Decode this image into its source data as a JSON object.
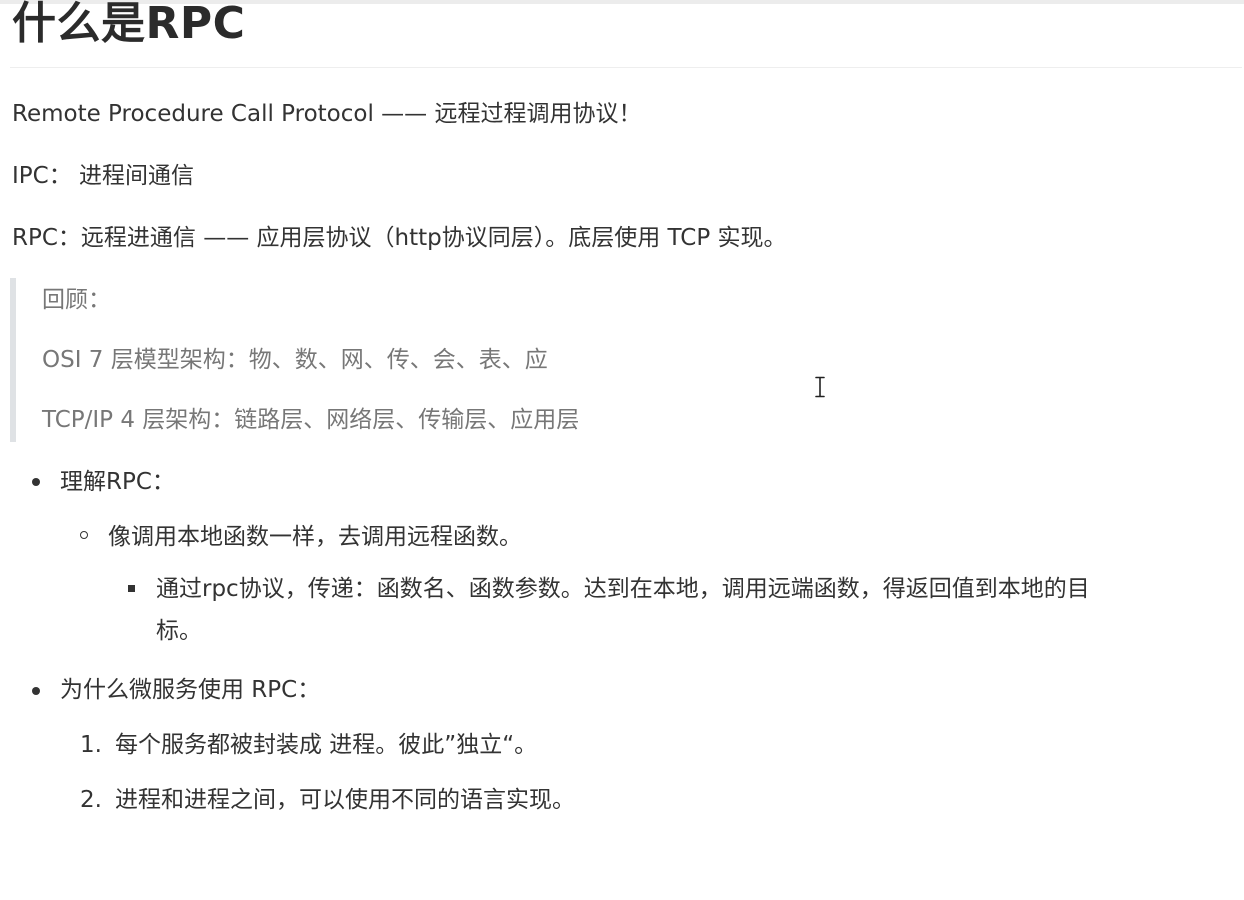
{
  "heading": "什么是RPC",
  "paragraphs": {
    "p1": "Remote Procedure Call Protocol   —— 远程过程调用协议！",
    "p2": "IPC：  进程间通信",
    "p3": "RPC：远程进通信 —— 应用层协议（http协议同层）。底层使用 TCP 实现。"
  },
  "quote": {
    "line1": "回顾：",
    "line2": "OSI 7 层模型架构：物、数、网、传、会、表、应",
    "line3": "TCP/IP 4 层架构：链路层、网络层、传输层、应用层"
  },
  "list1": {
    "title": "理解RPC：",
    "sub": "像调用本地函数一样，去调用远程函数。",
    "subsub_line1": "通过rpc协议，传递：函数名、函数参数。达到在本地，调用远端函数，得返回值到本地的目",
    "subsub_line2": "标。"
  },
  "list2": {
    "title": "为什么微服务使用 RPC：",
    "items": [
      {
        "num": "1.",
        "text": "每个服务都被封装成 进程。彼此”独立“。"
      },
      {
        "num": "2.",
        "text": "进程和进程之间，可以使用不同的语言实现。"
      }
    ]
  },
  "icons": {
    "cursor": "text-cursor-icon"
  }
}
